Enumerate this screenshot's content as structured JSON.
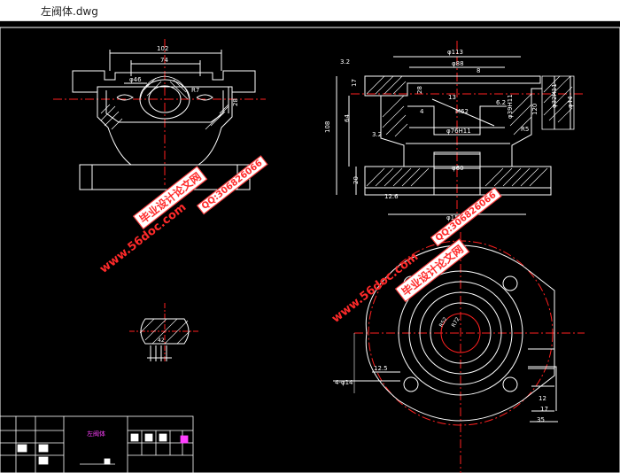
{
  "window": {
    "title": "左阀体.dwg"
  },
  "colors": {
    "background": "#000000",
    "line": "#ffffff",
    "center": "#ff2020",
    "dim": "#ffffff"
  },
  "dims": {
    "d102": "102",
    "d74": "74",
    "phi46": "φ46",
    "r7": "R7",
    "d28": "28",
    "phi113": "φ113",
    "phi88": "φ88",
    "r32": "3.2",
    "d17": "17",
    "d8": "8",
    "d28b": "28",
    "d13": "13",
    "d4": "4",
    "m62": "M62",
    "r62b": "6.2",
    "phi76": "φ76H11",
    "phi39": "φ39H11",
    "d20": "20",
    "d64": "64",
    "d108": "108",
    "phi60": "φ60",
    "phi150": "φ150",
    "d126": "12.6",
    "phi32": "φ32H11",
    "phi44": "φ44",
    "d120": "120",
    "r5": "R5",
    "phi14": "4-φ14",
    "d125": "12.5",
    "l2": "12",
    "l7": "17",
    "d35": "35",
    "d33": "3.2",
    "r52": "R52",
    "r72": "R72",
    "d42": "42"
  },
  "watermarks": {
    "site_a": "www.56doc.com",
    "qq_a": "QQ:306826066",
    "name_a": "毕业设计论文网",
    "site_b": "www.56doc.com",
    "qq_b": "QQ:306826066",
    "name_b": "毕业设计论文网"
  },
  "title_block": {
    "part_name": "左阀体"
  }
}
